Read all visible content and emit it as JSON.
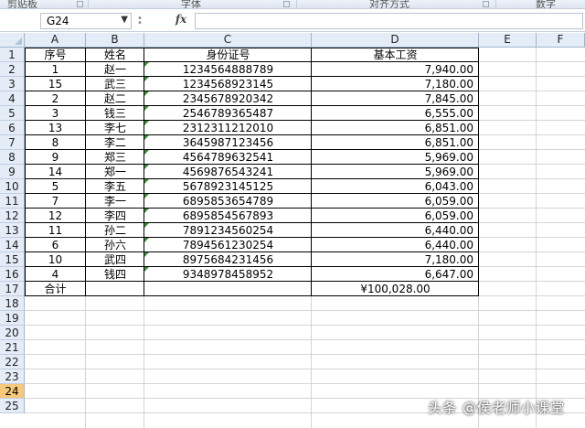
{
  "ribbon": {
    "groups": [
      "剪贴板",
      "字体",
      "对齐方式",
      "数字"
    ]
  },
  "formula_bar": {
    "name_box": "G24",
    "fx_label": "fx",
    "formula": ""
  },
  "columns": [
    "A",
    "B",
    "C",
    "D",
    "E",
    "F"
  ],
  "rows": [
    "1",
    "2",
    "3",
    "4",
    "5",
    "6",
    "7",
    "8",
    "9",
    "10",
    "11",
    "12",
    "13",
    "14",
    "15",
    "16",
    "17",
    "18",
    "19",
    "20",
    "21",
    "22",
    "23",
    "24",
    "25"
  ],
  "active_row": "24",
  "table": {
    "headers": [
      "序号",
      "姓名",
      "身份证号",
      "基本工资"
    ],
    "records": [
      [
        "1",
        "赵一",
        "1234564888789",
        "7,940.00"
      ],
      [
        "15",
        "武三",
        "1234568923145",
        "7,180.00"
      ],
      [
        "2",
        "赵二",
        "2345678920342",
        "7,845.00"
      ],
      [
        "3",
        "钱三",
        "2546789365487",
        "6,555.00"
      ],
      [
        "13",
        "李七",
        "2312311212010",
        "6,851.00"
      ],
      [
        "8",
        "李二",
        "3645987123456",
        "6,851.00"
      ],
      [
        "9",
        "郑三",
        "4564789632541",
        "5,969.00"
      ],
      [
        "14",
        "郑一",
        "4569876543241",
        "5,969.00"
      ],
      [
        "5",
        "李五",
        "5678923145125",
        "6,043.00"
      ],
      [
        "7",
        "李一",
        "6895853654789",
        "6,059.00"
      ],
      [
        "12",
        "李四",
        "6895854567893",
        "6,059.00"
      ],
      [
        "11",
        "孙二",
        "7891234560254",
        "6,440.00"
      ],
      [
        "6",
        "孙六",
        "7894561230254",
        "6,440.00"
      ],
      [
        "10",
        "武四",
        "8975684231456",
        "7,180.00"
      ],
      [
        "4",
        "钱四",
        "9348978458952",
        "6,647.00"
      ]
    ],
    "total_label": "合计",
    "total_value": "¥100,028.00"
  },
  "watermark": "头条 @侯老师小课堂"
}
